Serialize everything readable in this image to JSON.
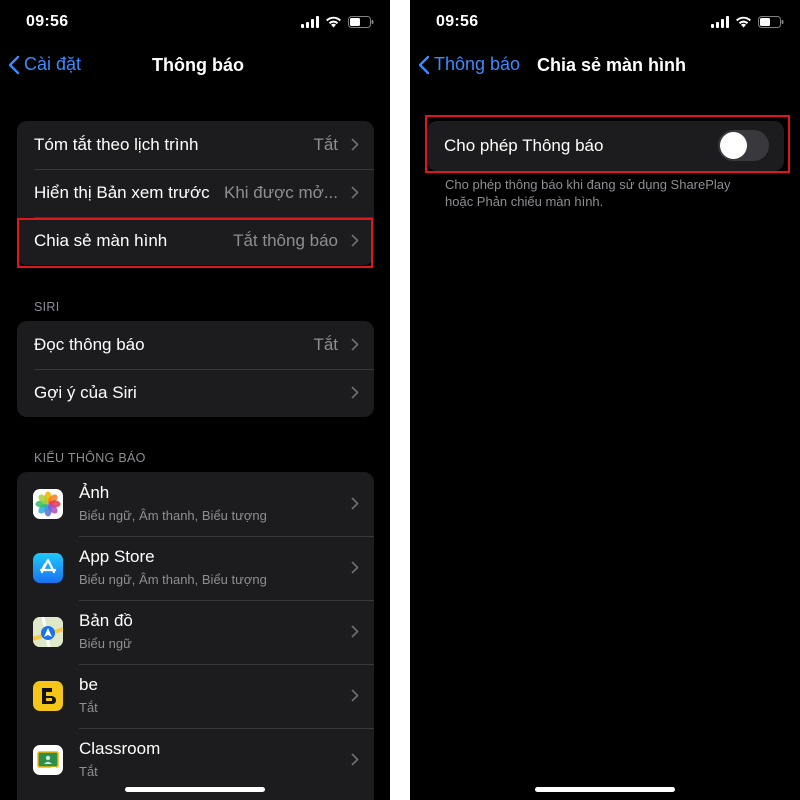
{
  "left": {
    "status": {
      "time": "09:56"
    },
    "nav": {
      "back": "Cài đặt",
      "title": "Thông báo"
    },
    "group1": [
      {
        "label": "Tóm tắt theo lịch trình",
        "value": "Tắt"
      },
      {
        "label": "Hiển thị Bản xem trước",
        "value": "Khi được mở..."
      },
      {
        "label": "Chia sẻ màn hình",
        "value": "Tắt thông báo"
      }
    ],
    "siri_header": "SIRI",
    "siri": [
      {
        "label": "Đọc thông báo",
        "value": "Tắt"
      },
      {
        "label": "Gợi ý của Siri",
        "value": ""
      }
    ],
    "style_header": "KIỂU THÔNG BÁO",
    "apps": [
      {
        "name": "Ảnh",
        "sub": "Biểu ngữ, Âm thanh, Biểu tượng",
        "icon": "photos-icon"
      },
      {
        "name": "App Store",
        "sub": "Biểu ngữ, Âm thanh, Biểu tượng",
        "icon": "app-store-icon"
      },
      {
        "name": "Bản đồ",
        "sub": "Biểu ngữ",
        "icon": "maps-icon"
      },
      {
        "name": "be",
        "sub": "Tắt",
        "icon": "be-icon"
      },
      {
        "name": "Classroom",
        "sub": "Tắt",
        "icon": "classroom-icon"
      }
    ]
  },
  "right": {
    "status": {
      "time": "09:56"
    },
    "nav": {
      "back": "Thông báo",
      "title": "Chia sẻ màn hình"
    },
    "toggle_label": "Cho phép Thông báo",
    "toggle_on": false,
    "footnote_line1": "Cho phép thông báo khi đang sử dụng SharePlay",
    "footnote_line2": "hoặc Phản chiếu màn hình."
  },
  "colors": {
    "accent": "#3b8bff",
    "highlight": "#e0161d",
    "cell": "#1c1c1e",
    "secondary": "#8e8e93"
  }
}
